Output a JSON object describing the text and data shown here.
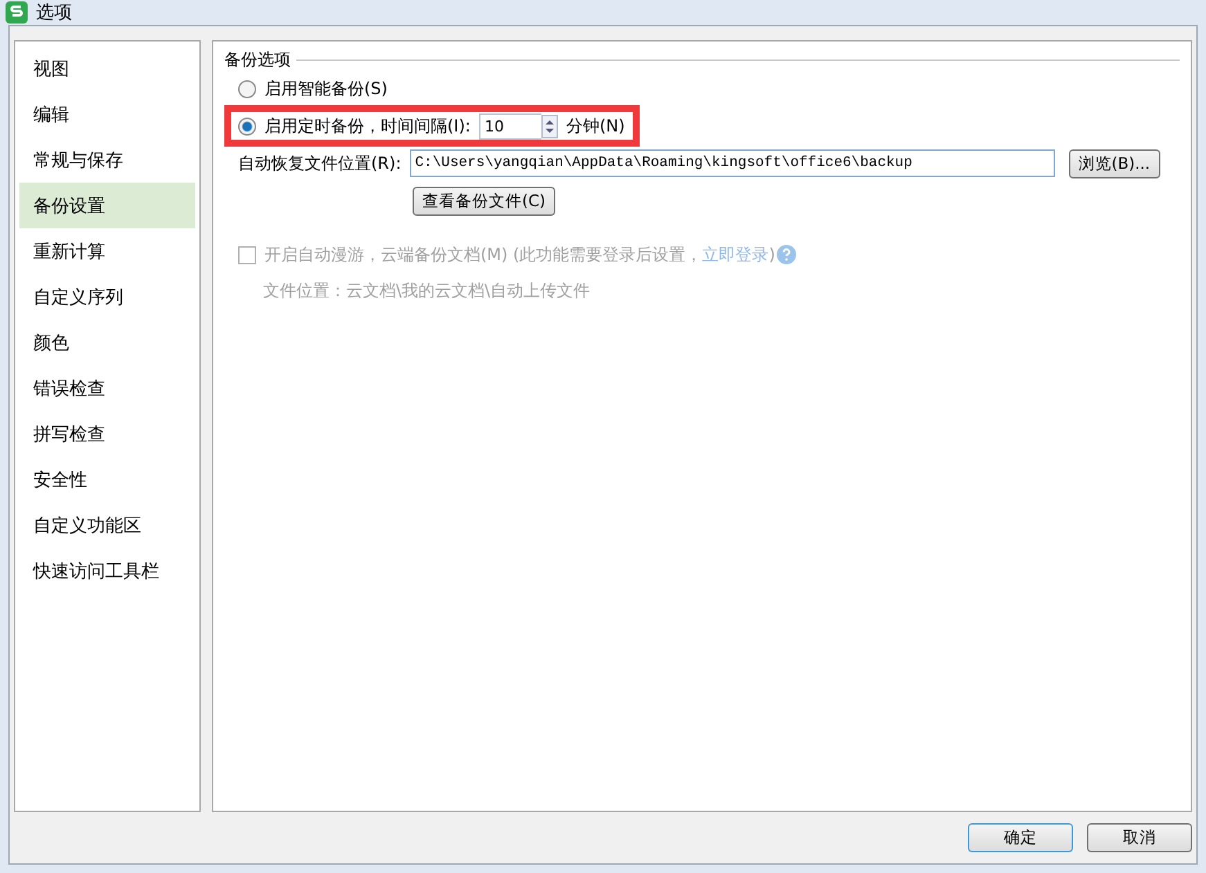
{
  "window": {
    "title": "选项"
  },
  "sidebar": {
    "items": [
      {
        "label": "视图",
        "selected": false
      },
      {
        "label": "编辑",
        "selected": false
      },
      {
        "label": "常规与保存",
        "selected": false
      },
      {
        "label": "备份设置",
        "selected": true
      },
      {
        "label": "重新计算",
        "selected": false
      },
      {
        "label": "自定义序列",
        "selected": false
      },
      {
        "label": "颜色",
        "selected": false
      },
      {
        "label": "错误检查",
        "selected": false
      },
      {
        "label": "拼写检查",
        "selected": false
      },
      {
        "label": "安全性",
        "selected": false
      },
      {
        "label": "自定义功能区",
        "selected": false
      },
      {
        "label": "快速访问工具栏",
        "selected": false
      }
    ]
  },
  "backup": {
    "group_title": "备份选项",
    "options": [
      {
        "label": "启用智能备份(S)",
        "selected": false
      },
      {
        "label": "启用定时备份，时间间隔(I):",
        "selected": true,
        "interval": "10",
        "unit": "分钟(N)"
      }
    ],
    "location_label": "自动恢复文件位置(R):",
    "location": "C:\\Users\\yangqian\\AppData\\Roaming\\kingsoft\\office6\\backup",
    "browse": "浏览(B)...",
    "view_button": "查看备份文件(C)",
    "cloud": {
      "label": "开启自动漫游，云端备份文档(M) (此功能需要登录后设置，",
      "link": "立即登录",
      "after": ")",
      "checked": false,
      "disabled": true,
      "path": "文件位置：云文档\\我的云文档\\自动上传文件"
    }
  },
  "buttons": [
    {
      "label": "确定",
      "default": true
    },
    {
      "label": "取消",
      "default": false
    }
  ]
}
